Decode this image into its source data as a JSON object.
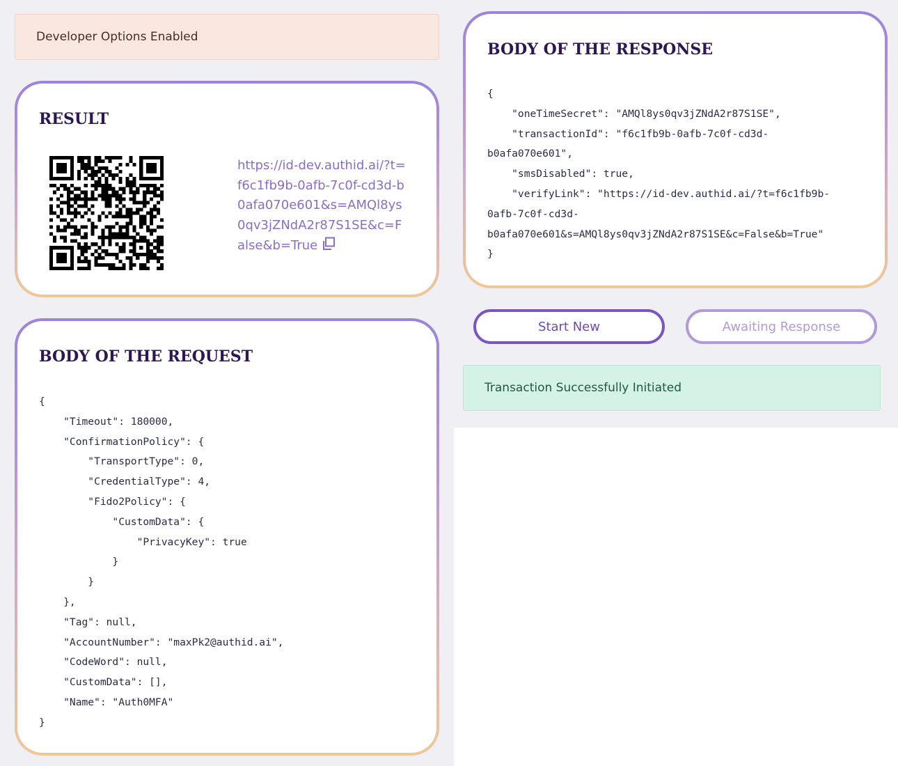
{
  "alerts": {
    "developer": "Developer Options Enabled",
    "success": "Transaction Successfully Initiated"
  },
  "result": {
    "title": "RESULT",
    "verify_link": "https://id-dev.authid.ai/?t=f6c1fb9b-0afb-7c0f-cd3d-b0afa070e601&s=AMQl8ys0qv3jZNdA2r87S1SE&c=False&b=True",
    "copy_icon": "copy-icon",
    "qr_icon": "qr-code"
  },
  "request": {
    "title": "BODY OF THE REQUEST",
    "json_text": "{\n    \"Timeout\": 180000,\n    \"ConfirmationPolicy\": {\n        \"TransportType\": 0,\n        \"CredentialType\": 4,\n        \"Fido2Policy\": {\n            \"CustomData\": {\n                \"PrivacyKey\": true\n            }\n        }\n    },\n    \"Tag\": null,\n    \"AccountNumber\": \"maxPk2@authid.ai\",\n    \"CodeWord\": null,\n    \"CustomData\": [],\n    \"Name\": \"Auth0MFA\"\n}"
  },
  "response": {
    "title": "BODY OF THE RESPONSE",
    "json_text": "{\n    \"oneTimeSecret\": \"AMQl8ys0qv3jZNdA2r87S1SE\",\n    \"transactionId\": \"f6c1fb9b-0afb-7c0f-cd3d-\nb0afa070e601\",\n    \"smsDisabled\": true,\n    \"verifyLink\": \"https://id-dev.authid.ai/?t=f6c1fb9b-\n0afb-7c0f-cd3d-\nb0afa070e601&s=AMQl8ys0qv3jZNdA2r87S1SE&c=False&b=True\"\n}"
  },
  "buttons": {
    "start_new": "Start New",
    "awaiting": "Awaiting Response"
  },
  "colors": {
    "accent": "#7b55c1",
    "link": "#8a6dc9",
    "title": "#2d1652",
    "dev_alert_bg": "#fae8e0",
    "success_alert_bg": "#d4f2e6"
  }
}
